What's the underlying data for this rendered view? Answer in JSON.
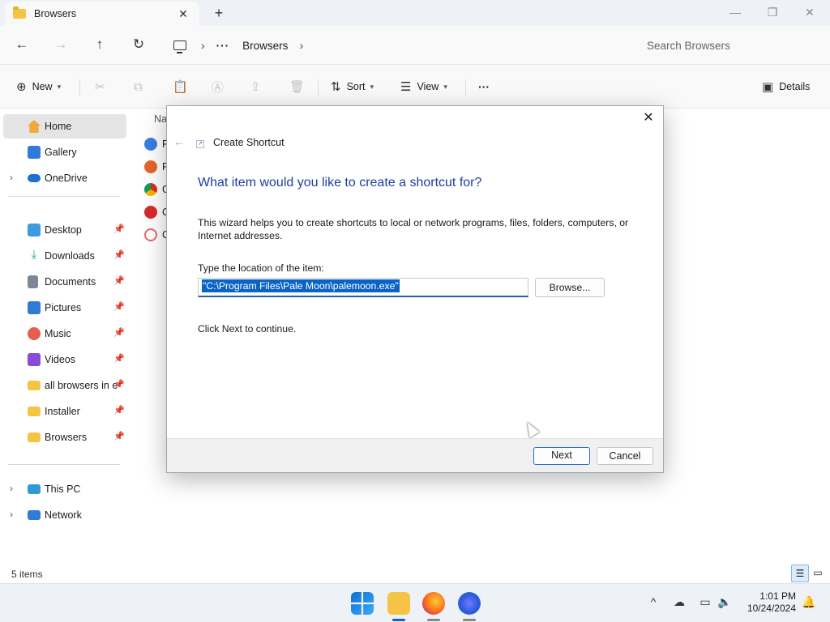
{
  "window": {
    "tab_title": "Browsers",
    "tab_close": "✕",
    "new_tab": "+",
    "minimize": "—",
    "maximize": "❐",
    "close": "✕"
  },
  "address": {
    "breadcrumb_dots": "···",
    "breadcrumb_folder": "Browsers",
    "separator": "›",
    "search_placeholder": "Search Browsers"
  },
  "commands": {
    "new": "New",
    "sort": "Sort",
    "view": "View",
    "more": "···",
    "details": "Details"
  },
  "sidebar": {
    "items": [
      {
        "label": "Home",
        "color": "#f0a93b"
      },
      {
        "label": "Gallery",
        "color": "#2f7bd6"
      },
      {
        "label": "OneDrive",
        "color": "#1f6fd1"
      },
      {
        "label": "Desktop",
        "color": "#3d9be0"
      },
      {
        "label": "Downloads",
        "color": "#2fa36b"
      },
      {
        "label": "Documents",
        "color": "#7b8794"
      },
      {
        "label": "Pictures",
        "color": "#2f7bd6"
      },
      {
        "label": "Music",
        "color": "#e3604a"
      },
      {
        "label": "Videos",
        "color": "#8a4bd6"
      },
      {
        "label": "all browsers in e",
        "color": "#f6c445"
      },
      {
        "label": "Installer",
        "color": "#f6c445"
      },
      {
        "label": "Browsers",
        "color": "#f6c445"
      },
      {
        "label": "This PC",
        "color": "#2f9bd6"
      },
      {
        "label": "Network",
        "color": "#2f7bd6"
      }
    ],
    "pin_icon": "📌"
  },
  "filelist": {
    "column_name": "Na",
    "rows": [
      {
        "label": "Fi",
        "color": "#3b7ee0"
      },
      {
        "label": "Fi",
        "color": "#e8632a"
      },
      {
        "label": "G",
        "color": "#2fa35a"
      },
      {
        "label": "O",
        "color": "#d82a2a"
      },
      {
        "label": "O",
        "color": "#e46a6a"
      }
    ]
  },
  "dialog": {
    "close": "✕",
    "back_arrow": "←",
    "title": "Create Shortcut",
    "heading": "What item would you like to create a shortcut for?",
    "description": "This wizard helps you to create shortcuts to local or network programs, files, folders, computers, or Internet addresses.",
    "location_label": "Type the location of the item:",
    "location_value": "\"C:\\Program Files\\Pale Moon\\palemoon.exe\"",
    "browse_button": "Browse...",
    "continue_text": "Click Next to continue.",
    "next_button": "Next",
    "cancel_button": "Cancel"
  },
  "status": {
    "item_count": "5 items"
  },
  "taskbar": {
    "time": "1:01 PM",
    "date": "10/24/2024",
    "tray_chevron": "^"
  }
}
